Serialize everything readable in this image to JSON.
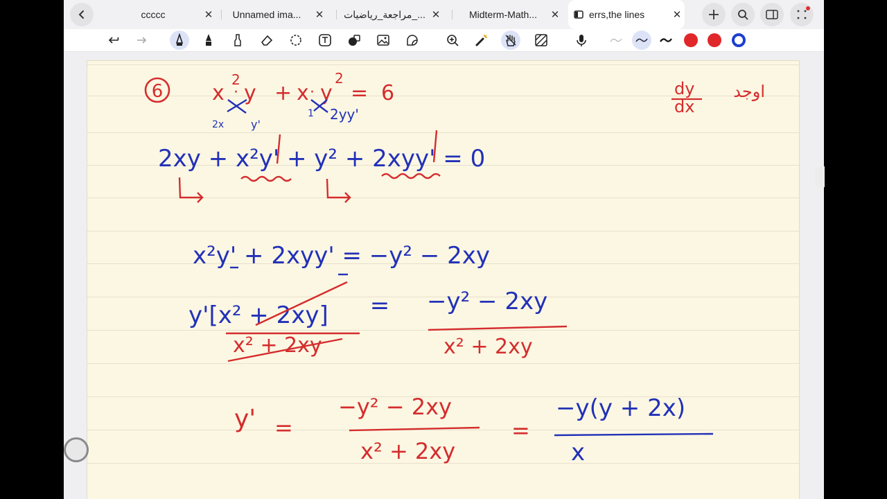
{
  "tabs": [
    {
      "label": "ccccc",
      "active": false
    },
    {
      "label": "Unnamed ima...",
      "active": false
    },
    {
      "label": "مراجعة_رياضيات_...",
      "active": false
    },
    {
      "label": "Midterm-Math...",
      "active": false
    },
    {
      "label": "errs,the lines",
      "active": true
    }
  ],
  "colors": {
    "red_ink": "#d42d2d",
    "blue_ink": "#2231b8",
    "paper": "#fcf7e3",
    "pen_red": "#e0282a",
    "pen_blue": "#1d3fd0"
  },
  "notes": {
    "problem_number": "6",
    "original_equation": "x²·y + x·y² = 6",
    "goal": "dy/dx",
    "goal_arabic": "اوجد",
    "step1": "2xy + x²y' + y² + 2xyy' = 0",
    "step2": "x²y' + 2xyy' = −y² − 2xy",
    "step3_left": "y'[x² + 2xy]",
    "step3_right_num": "−y² − 2xy",
    "step3_right_den": "x² + 2xy",
    "result_left": "y'",
    "result_num": "−y² − 2xy",
    "result_den": "x² + 2xy",
    "simplified_num": "−y(y + 2x)",
    "simplified_den": "x"
  }
}
